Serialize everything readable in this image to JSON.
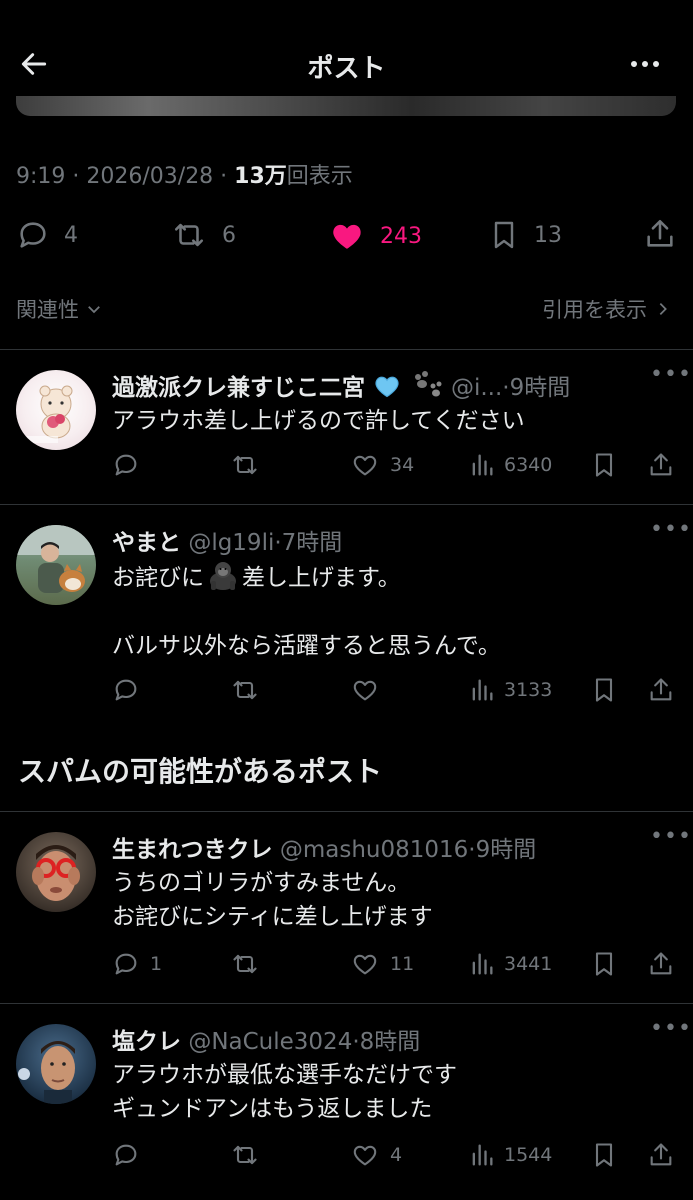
{
  "header": {
    "title": "ポスト"
  },
  "post_meta": {
    "time": "9:19 · 2026/03/28 · ",
    "views_count": "13万",
    "views_label": "回表示"
  },
  "post_stats": {
    "replies": "4",
    "reposts": "6",
    "likes": "243",
    "bookmarks": "13",
    "like_color": "#f91880"
  },
  "sort": {
    "label": "関連性",
    "quotes_link": "引用を表示"
  },
  "replies": [
    {
      "name": "過激派クレ兼すじこ二宮",
      "handle": "@i...",
      "time": "·9時間",
      "text": "アラウホ差し上げるので許してください",
      "reply_count": "",
      "repost_count": "",
      "like_count": "34",
      "view_count": "6340"
    },
    {
      "name": "やまと",
      "handle": "@lg19li",
      "time": "·7時間",
      "text_a": "お詫びに",
      "text_b": "差し上げます。\n\nバルサ以外なら活躍すると思うんで。",
      "reply_count": "",
      "repost_count": "",
      "like_count": "",
      "view_count": "3133"
    }
  ],
  "spam_section": {
    "title": "スパムの可能性があるポスト"
  },
  "spam_replies": [
    {
      "name": "生まれつきクレ",
      "handle": "@mashu081016",
      "time": "·9時間",
      "text": "うちのゴリラがすみません。\nお詫びにシティに差し上げます",
      "reply_count": "1",
      "repost_count": "",
      "like_count": "11",
      "view_count": "3441"
    },
    {
      "name": "塩クレ",
      "handle": "@NaCule3024",
      "time": "·8時間",
      "text": "アラウホが最低な選手なだけです\nギュンドアンはもう返しました",
      "reply_count": "",
      "repost_count": "",
      "like_count": "4",
      "view_count": "1544"
    }
  ],
  "icons": {
    "reply": "comment-icon",
    "repost": "repost-icon",
    "like": "heart-icon",
    "views": "bar-chart-icon",
    "bookmark": "bookmark-icon",
    "share": "share-icon"
  }
}
